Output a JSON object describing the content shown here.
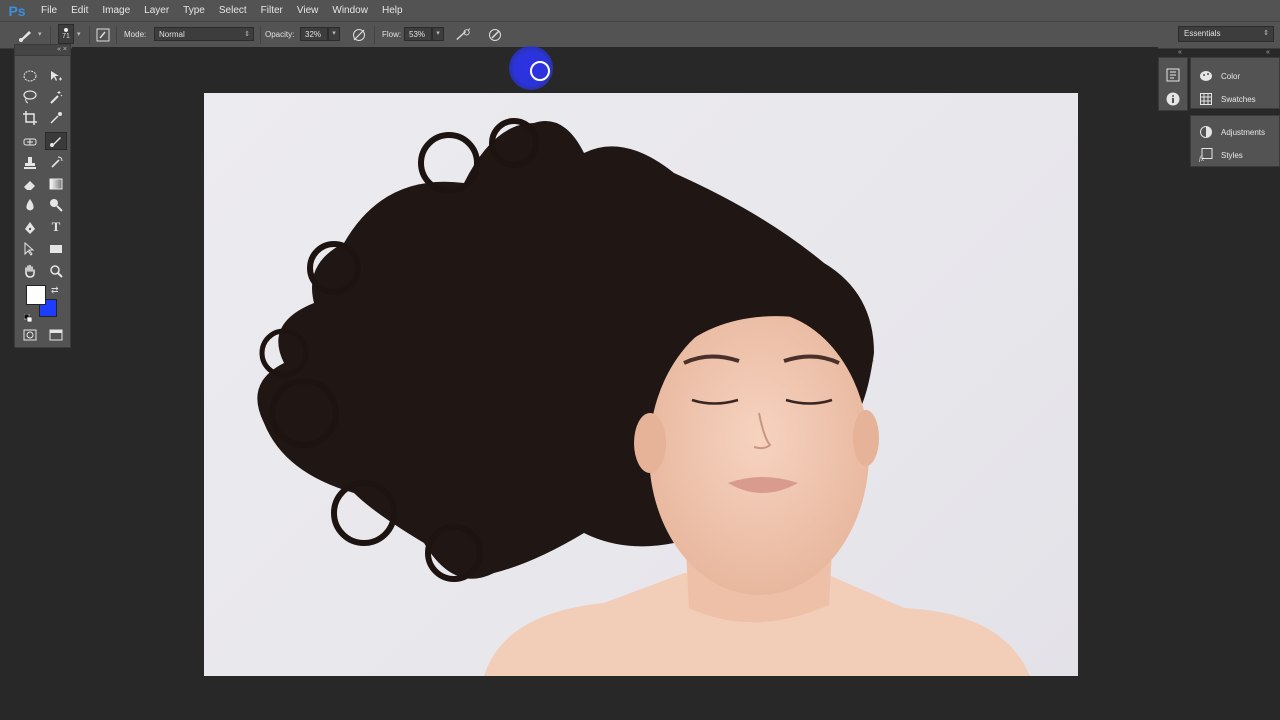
{
  "app": {
    "logo": "Ps"
  },
  "menu": [
    "File",
    "Edit",
    "Image",
    "Layer",
    "Type",
    "Select",
    "Filter",
    "View",
    "Window",
    "Help"
  ],
  "options": {
    "brush_size": "71",
    "mode_label": "Mode:",
    "mode_value": "Normal",
    "opacity_label": "Opacity:",
    "opacity_value": "32%",
    "flow_label": "Flow:",
    "flow_value": "53%",
    "workspace": "Essentials"
  },
  "colors": {
    "foreground": "#ffffff",
    "background": "#1e3cff",
    "accent": "#3b8fe0"
  },
  "panels": {
    "group1": [
      {
        "label": "Color",
        "icon": "color-icon"
      },
      {
        "label": "Swatches",
        "icon": "swatches-icon"
      }
    ],
    "group2": [
      {
        "label": "Adjustments",
        "icon": "adjustments-icon"
      },
      {
        "label": "Styles",
        "icon": "styles-icon"
      }
    ]
  }
}
